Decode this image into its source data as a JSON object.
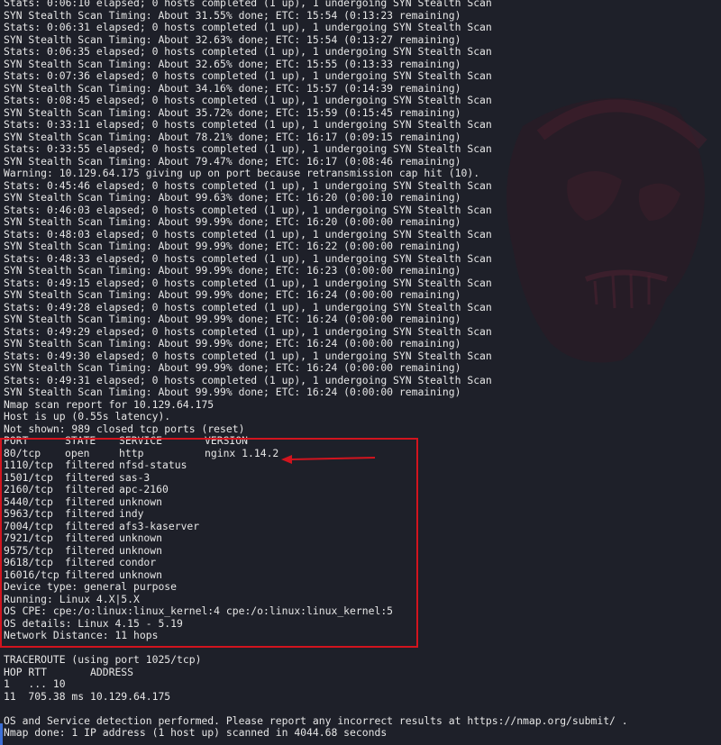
{
  "terminal": {
    "progress_lines": [
      "Stats: 0:06:10 elapsed; 0 hosts completed (1 up), 1 undergoing SYN Stealth Scan",
      "SYN Stealth Scan Timing: About 31.55% done; ETC: 15:54 (0:13:23 remaining)",
      "Stats: 0:06:31 elapsed; 0 hosts completed (1 up), 1 undergoing SYN Stealth Scan",
      "SYN Stealth Scan Timing: About 32.63% done; ETC: 15:54 (0:13:27 remaining)",
      "Stats: 0:06:35 elapsed; 0 hosts completed (1 up), 1 undergoing SYN Stealth Scan",
      "SYN Stealth Scan Timing: About 32.65% done; ETC: 15:55 (0:13:33 remaining)",
      "Stats: 0:07:36 elapsed; 0 hosts completed (1 up), 1 undergoing SYN Stealth Scan",
      "SYN Stealth Scan Timing: About 34.16% done; ETC: 15:57 (0:14:39 remaining)",
      "Stats: 0:08:45 elapsed; 0 hosts completed (1 up), 1 undergoing SYN Stealth Scan",
      "SYN Stealth Scan Timing: About 35.72% done; ETC: 15:59 (0:15:45 remaining)",
      "Stats: 0:33:11 elapsed; 0 hosts completed (1 up), 1 undergoing SYN Stealth Scan",
      "SYN Stealth Scan Timing: About 78.21% done; ETC: 16:17 (0:09:15 remaining)",
      "Stats: 0:33:55 elapsed; 0 hosts completed (1 up), 1 undergoing SYN Stealth Scan",
      "SYN Stealth Scan Timing: About 79.47% done; ETC: 16:17 (0:08:46 remaining)",
      "Warning: 10.129.64.175 giving up on port because retransmission cap hit (10).",
      "Stats: 0:45:46 elapsed; 0 hosts completed (1 up), 1 undergoing SYN Stealth Scan",
      "SYN Stealth Scan Timing: About 99.63% done; ETC: 16:20 (0:00:10 remaining)",
      "Stats: 0:46:03 elapsed; 0 hosts completed (1 up), 1 undergoing SYN Stealth Scan",
      "SYN Stealth Scan Timing: About 99.99% done; ETC: 16:20 (0:00:00 remaining)",
      "Stats: 0:48:03 elapsed; 0 hosts completed (1 up), 1 undergoing SYN Stealth Scan",
      "SYN Stealth Scan Timing: About 99.99% done; ETC: 16:22 (0:00:00 remaining)",
      "Stats: 0:48:33 elapsed; 0 hosts completed (1 up), 1 undergoing SYN Stealth Scan",
      "SYN Stealth Scan Timing: About 99.99% done; ETC: 16:23 (0:00:00 remaining)",
      "Stats: 0:49:15 elapsed; 0 hosts completed (1 up), 1 undergoing SYN Stealth Scan",
      "SYN Stealth Scan Timing: About 99.99% done; ETC: 16:24 (0:00:00 remaining)",
      "Stats: 0:49:28 elapsed; 0 hosts completed (1 up), 1 undergoing SYN Stealth Scan",
      "SYN Stealth Scan Timing: About 99.99% done; ETC: 16:24 (0:00:00 remaining)",
      "Stats: 0:49:29 elapsed; 0 hosts completed (1 up), 1 undergoing SYN Stealth Scan",
      "SYN Stealth Scan Timing: About 99.99% done; ETC: 16:24 (0:00:00 remaining)",
      "Stats: 0:49:30 elapsed; 0 hosts completed (1 up), 1 undergoing SYN Stealth Scan",
      "SYN Stealth Scan Timing: About 99.99% done; ETC: 16:24 (0:00:00 remaining)",
      "Stats: 0:49:31 elapsed; 0 hosts completed (1 up), 1 undergoing SYN Stealth Scan",
      "SYN Stealth Scan Timing: About 99.99% done; ETC: 16:24 (0:00:00 remaining)"
    ],
    "report_header": "Nmap scan report for 10.129.64.175",
    "host_status": "Host is up (0.55s latency).",
    "not_shown": "Not shown: 989 closed tcp ports (reset)",
    "port_table": {
      "headers": [
        "PORT",
        "STATE",
        "SERVICE",
        "VERSION"
      ],
      "rows": [
        [
          "80/tcp",
          "open",
          "http",
          "nginx 1.14.2"
        ],
        [
          "1110/tcp",
          "filtered",
          "nfsd-status",
          ""
        ],
        [
          "1501/tcp",
          "filtered",
          "sas-3",
          ""
        ],
        [
          "2160/tcp",
          "filtered",
          "apc-2160",
          ""
        ],
        [
          "5440/tcp",
          "filtered",
          "unknown",
          ""
        ],
        [
          "5963/tcp",
          "filtered",
          "indy",
          ""
        ],
        [
          "7004/tcp",
          "filtered",
          "afs3-kaserver",
          ""
        ],
        [
          "7921/tcp",
          "filtered",
          "unknown",
          ""
        ],
        [
          "9575/tcp",
          "filtered",
          "unknown",
          ""
        ],
        [
          "9618/tcp",
          "filtered",
          "condor",
          ""
        ],
        [
          "16016/tcp",
          "filtered",
          "unknown",
          ""
        ]
      ]
    },
    "os_info": [
      "Device type: general purpose",
      "Running: Linux 4.X|5.X",
      "OS CPE: cpe:/o:linux:linux_kernel:4 cpe:/o:linux:linux_kernel:5",
      "OS details: Linux 4.15 - 5.19",
      "Network Distance: 11 hops"
    ],
    "traceroute": {
      "title": "TRACEROUTE (using port 1025/tcp)",
      "header": "HOP RTT       ADDRESS",
      "hops": [
        "1   ... 10",
        "11  705.38 ms 10.129.64.175"
      ]
    },
    "footer": [
      "OS and Service detection performed. Please report any incorrect results at https://nmap.org/submit/ .",
      "Nmap done: 1 IP address (1 host up) scanned in 4044.68 seconds"
    ]
  },
  "colors": {
    "background": "#1e2029",
    "text": "#e6e6e6",
    "annotation_red": "#d2141e",
    "side_marker": "#3d6fd6"
  },
  "icons": [
    "background-skull-art",
    "annotation-arrow-icon"
  ]
}
